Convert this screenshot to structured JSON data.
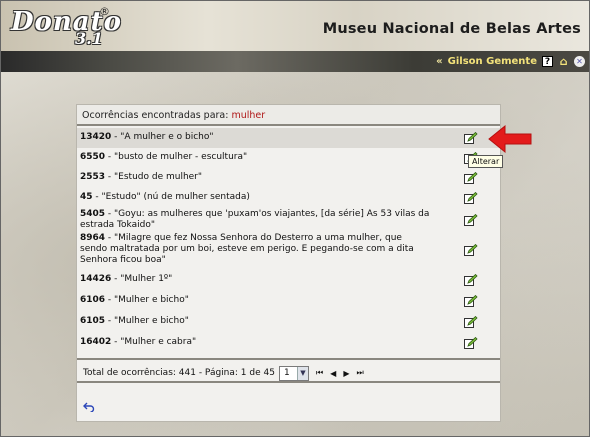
{
  "header": {
    "logo_word": "Donato",
    "logo_number": "3.1",
    "logo_registered": "®",
    "museum_title": "Museu Nacional de Belas Artes"
  },
  "userbar": {
    "arrow": "«",
    "user_name": "Gilson Gemente",
    "help_glyph": "?",
    "home_glyph": "⌂",
    "close_glyph": "✕"
  },
  "results": {
    "heading_prefix": "Ocorrências encontradas para:",
    "search_term": "mulher",
    "items": [
      {
        "id": "13420",
        "text": " - \"A mulher e o bicho\""
      },
      {
        "id": "6550",
        "text": " - \"busto de mulher - escultura\""
      },
      {
        "id": "2553",
        "text": " - \"Estudo de mulher\""
      },
      {
        "id": "45",
        "text": " - \"Estudo\" (nú de mulher sentada)"
      },
      {
        "id": "5405",
        "text": " - \"Goyu: as mulheres que 'puxam'os viajantes, [da série] As 53 vilas da estrada Tokaido\""
      },
      {
        "id": "8964",
        "text": " - \"Milagre que fez Nossa Senhora do Desterro a uma mulher, que sendo maltratada por um boi, esteve em perigo. E pegando-se com a dita Senhora ficou boa\""
      },
      {
        "id": "14426",
        "text": " - \"Mulher 1º\""
      },
      {
        "id": "6106",
        "text": " - \"Mulher e bicho\""
      },
      {
        "id": "6105",
        "text": " - \"Mulher e bicho\""
      },
      {
        "id": "16402",
        "text": " - \"Mulher e cabra\""
      }
    ],
    "footer_text": "Total de ocorrências: 441 - Página: 1 de 45",
    "page_select_value": "1",
    "nav_first": "⏮",
    "nav_prev": "◀",
    "nav_next": "▶",
    "nav_last": "⏭"
  },
  "tooltip": {
    "text": "Alterar"
  },
  "colors": {
    "accent_red": "#e31b1b",
    "search_term": "#b01818",
    "user_name": "#f3e27a"
  }
}
